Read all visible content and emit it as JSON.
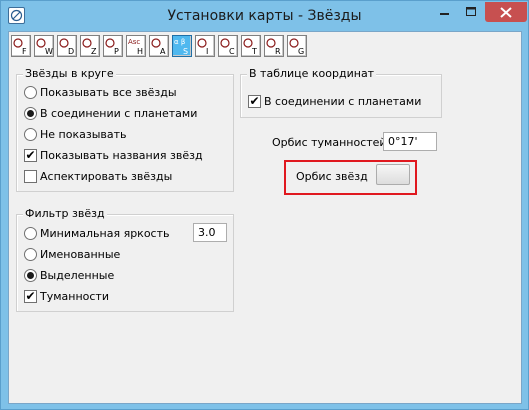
{
  "window": {
    "title": "Установки карты - Звёзды",
    "accent": "#7ec1e8",
    "close_color": "#c75050",
    "controls": {
      "minimize": "minimize-icon",
      "maximize": "maximize-icon",
      "close": "close-icon"
    }
  },
  "toolbar": {
    "buttons": [
      {
        "icon": "planet-sign-icon",
        "letter": "F"
      },
      {
        "icon": "circle-w-icon",
        "letter": "W"
      },
      {
        "icon": "circle-d-icon",
        "letter": "D"
      },
      {
        "icon": "aspect-z-icon",
        "letter": "Z"
      },
      {
        "icon": "gender-p-icon",
        "letter": "P"
      },
      {
        "icon": "asc-h-icon",
        "letter": "H",
        "top": "Asc"
      },
      {
        "icon": "shapes-a-icon",
        "letter": "A"
      },
      {
        "icon": "stars-s-icon",
        "letter": "S",
        "active": true,
        "top": "α β"
      },
      {
        "icon": "frames-i-icon",
        "letter": "I"
      },
      {
        "icon": "colors-c-icon",
        "letter": "C"
      },
      {
        "icon": "text-t-icon",
        "letter": "T"
      },
      {
        "icon": "page-r-icon",
        "letter": "R"
      },
      {
        "icon": "grid-g-icon",
        "letter": "G"
      }
    ]
  },
  "stars_in_circle": {
    "title": "Звёзды в круге",
    "options": [
      {
        "label": "Показывать все звёзды",
        "checked": false
      },
      {
        "label": "В соединении с планетами",
        "checked": true
      },
      {
        "label": "Не показывать",
        "checked": false
      }
    ],
    "show_names": {
      "label": "Показывать названия звёзд",
      "checked": true
    },
    "aspect_stars": {
      "label": "Аспектировать звёзды",
      "checked": false
    }
  },
  "coord_table": {
    "title": "В таблице координат",
    "in_conjunction": {
      "label": "В соединении с планетами",
      "checked": true
    }
  },
  "nebula_orb": {
    "label": "Орбис туманностей",
    "value": "0°17'"
  },
  "star_orb": {
    "label": "Орбис звёзд"
  },
  "star_filter": {
    "title": "Фильтр звёзд",
    "options": [
      {
        "label": "Минимальная яркость",
        "checked": false
      },
      {
        "label": "Именованные",
        "checked": false
      },
      {
        "label": "Выделенные",
        "checked": true
      }
    ],
    "min_brightness_value": "3.0",
    "nebulae": {
      "label": "Туманности",
      "checked": true
    }
  },
  "highlight_color": "#e0181f"
}
